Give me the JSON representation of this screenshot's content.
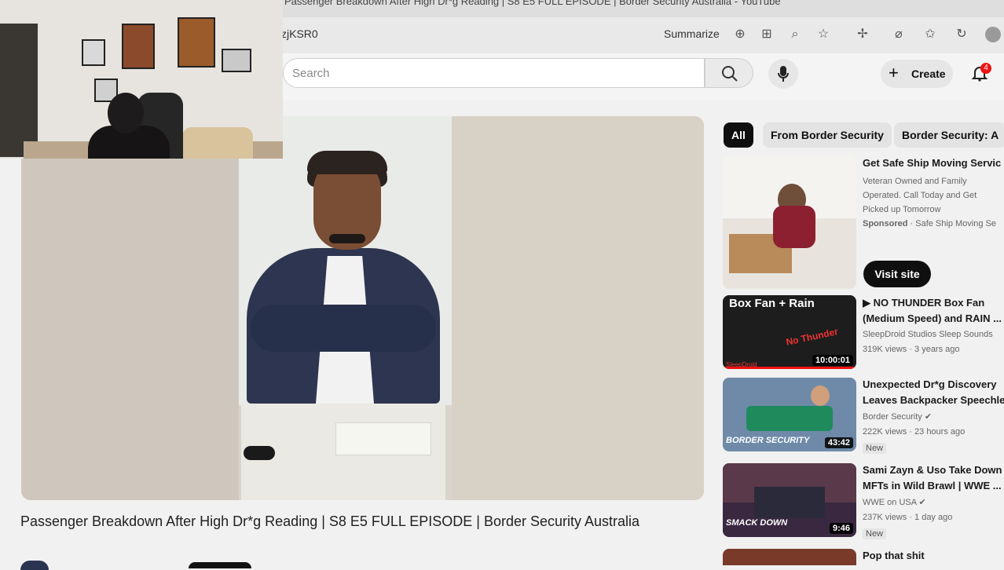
{
  "browser": {
    "tab_title": "Passenger Breakdown After High Dr*g Reading | S8 E5 FULL EPISODE | Border Security Australia - YouTube",
    "url_fragment": "zjKSR0",
    "summarize_label": "Summarize",
    "toolbar_icons": [
      "copilot-icon",
      "grid-icon",
      "zoom-icon",
      "star-icon",
      "extension-icon",
      "split-screen-icon",
      "favorites-icon",
      "history-icon",
      "profile-avatar"
    ]
  },
  "youtube": {
    "search_placeholder": "Search",
    "create_label": "Create",
    "notification_count": "4"
  },
  "video": {
    "title": "Passenger Breakdown After High Dr*g Reading | S8 E5 FULL EPISODE | Border Security Australia"
  },
  "chips": [
    "All",
    "From Border Security",
    "Border Security: A"
  ],
  "ad": {
    "title": "Get Safe Ship Moving Servic",
    "description": "Veteran Owned and Family Operated. Call Today and Get Picked up Tomorrow",
    "sponsored": "Sponsored",
    "advertiser": "Safe Ship Moving Se",
    "visit_label": "Visit site"
  },
  "recommendations": [
    {
      "title_line1": "▶ NO THUNDER Box Fan",
      "title_line2": "(Medium Speed) and RAIN ...",
      "channel": "SleepDroid Studios Sleep Sounds",
      "meta": "319K views · 3 years ago",
      "duration": "10:00:01",
      "thumb_text": "Box Fan + Rain",
      "thumb_sub": "No Thunder",
      "thumb_corner": "SleepDroid",
      "is_new": false
    },
    {
      "title_line1": "Unexpected Dr*g Discovery",
      "title_line2": "Leaves Backpacker Speechle",
      "channel": "Border Security",
      "meta": "222K views · 23 hours ago",
      "duration": "43:42",
      "thumb_text": "BORDER SECURITY",
      "is_new": true,
      "new_label": "New"
    },
    {
      "title_line1": "Sami Zayn & Uso Take Down",
      "title_line2": "MFTs in Wild Brawl | WWE ...",
      "channel": "WWE on USA",
      "meta": "237K views · 1 day ago",
      "duration": "9:46",
      "thumb_text": "SMACK DOWN",
      "is_new": true,
      "new_label": "New"
    },
    {
      "title_line1": "Pop that shit"
    }
  ],
  "colors": {
    "accent_red": "#e11111",
    "chip_active": "#0f0f0f"
  }
}
